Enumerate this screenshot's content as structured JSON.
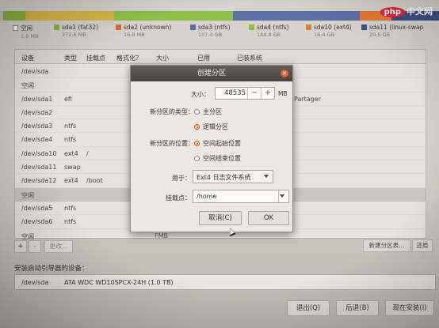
{
  "colors": {
    "free": "#c6c3bd",
    "sda1": "#8db43c",
    "sda2": "#e0673a",
    "sda3": "#5c6fa6",
    "sda4": "#8fbf4b",
    "sda10": "#e57a35",
    "sda11": "#3f4f86",
    "accent_radio": "#d6552a",
    "close_button": "#e5623a"
  },
  "legend": [
    {
      "name": "空闲",
      "size": "1.0 MB"
    },
    {
      "name": "sda1 (fat32)",
      "size": "272.6 MB"
    },
    {
      "name": "sda2 (unknown)",
      "size": "16.8 MB"
    },
    {
      "name": "sda3 (ntfs)",
      "size": "107.4 GB"
    },
    {
      "name": "sda4 (ntfs)",
      "size": "144.8 GB"
    },
    {
      "name": "sda10 (ext4)",
      "size": "16.4 GB"
    },
    {
      "name": "sda11 (linux-swap",
      "size": "20.5 GB"
    }
  ],
  "table": {
    "headers": [
      "设备",
      "类型",
      "挂载点",
      "格式化？",
      "大小",
      "已用",
      "已装系统"
    ],
    "rows": [
      {
        "device": "/dev/sda",
        "type": "",
        "mount": ""
      },
      {
        "device": "空闲",
        "type": "",
        "mount": ""
      },
      {
        "device": "/dev/sda1",
        "type": "efi",
        "mount": ""
      },
      {
        "device": "/dev/sda2",
        "type": "",
        "mount": ""
      },
      {
        "device": "/dev/sda3",
        "type": "ntfs",
        "mount": ""
      },
      {
        "device": "/dev/sda4",
        "type": "ntfs",
        "mount": ""
      },
      {
        "device": "/dev/sda10",
        "type": "ext4",
        "mount": "/"
      },
      {
        "device": "/dev/sda11",
        "type": "swap",
        "mount": ""
      },
      {
        "device": "/dev/sda12",
        "type": "ext4",
        "mount": "/boot"
      },
      {
        "device": "空闲",
        "type": "",
        "mount": ""
      },
      {
        "device": "/dev/sda5",
        "type": "ntfs",
        "mount": ""
      },
      {
        "device": "/dev/sda6",
        "type": "ntfs",
        "mount": ""
      },
      {
        "device": "空闲",
        "type": "",
        "mount": ""
      }
    ],
    "selected_row": 9,
    "side_text_1": "Partager",
    "side_text_2": "FMB"
  },
  "tools": {
    "add": "+",
    "remove": "-",
    "change": "更改..."
  },
  "new_partition_table_label": "新建分区表...",
  "revert_label": "还原",
  "boot_loader": {
    "label": "安装启动引导器的设备：",
    "device": "/dev/sda",
    "model": "ATA WDC WD10SPCX-24H (1.0 TB)"
  },
  "bottom_buttons": {
    "quit": "退出(Q)",
    "back": "后退(B)",
    "install_now": "现在安装(I)"
  },
  "dialog": {
    "title": "创建分区",
    "size_label": "大小：",
    "size_value": "48535",
    "size_unit": "MB",
    "type_label": "新分区的类型：",
    "type_options": [
      "主分区",
      "逻辑分区"
    ],
    "type_selected": "逻辑分区",
    "location_label": "新分区的位置：",
    "location_options": [
      "空间起始位置",
      "空间结束位置"
    ],
    "location_selected": "空间起始位置",
    "use_as_label": "用于：",
    "use_as_value": "Ext4 日志文件系统",
    "mount_label": "挂载点：",
    "mount_value": "/home",
    "cancel": "取消(C)",
    "ok": "OK"
  },
  "watermark": {
    "logo": "php",
    "text": "中文网"
  }
}
